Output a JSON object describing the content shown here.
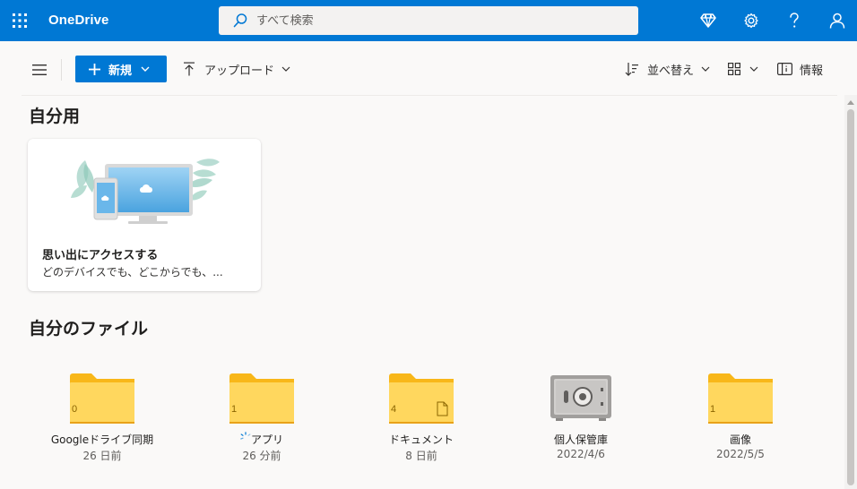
{
  "app": {
    "name": "OneDrive"
  },
  "search": {
    "placeholder": "すべて検索"
  },
  "commands": {
    "new_label": "新規",
    "upload_label": "アップロード",
    "sort_label": "並べ替え",
    "info_label": "情報"
  },
  "sections": {
    "for_you": "自分用",
    "my_files": "自分のファイル"
  },
  "card": {
    "title": "思い出にアクセスする",
    "description": "どのデバイスでも、どこからでも、..."
  },
  "files": [
    {
      "name": "Googleドライブ同期",
      "date": "26 日前",
      "count": "0",
      "type": "folder"
    },
    {
      "name": "アプリ",
      "date": "26 分前",
      "count": "1",
      "type": "folder",
      "syncing": true
    },
    {
      "name": "ドキュメント",
      "date": "8 日前",
      "count": "4",
      "type": "folder",
      "has_doc": true
    },
    {
      "name": "個人保管庫",
      "date": "2022/4/6",
      "type": "vault"
    },
    {
      "name": "画像",
      "date": "2022/5/5",
      "count": "1",
      "type": "folder"
    }
  ],
  "colors": {
    "brand": "#0078d4",
    "folder": "#ffd75e",
    "folder_tab": "#f8b719",
    "background": "#faf9f8"
  },
  "icons": [
    "app-launcher-icon",
    "search-icon",
    "premium-diamond-icon",
    "settings-gear-icon",
    "help-icon",
    "account-icon",
    "hamburger-icon",
    "upload-arrow-icon",
    "sort-icon",
    "view-grid-icon",
    "info-pane-icon"
  ]
}
